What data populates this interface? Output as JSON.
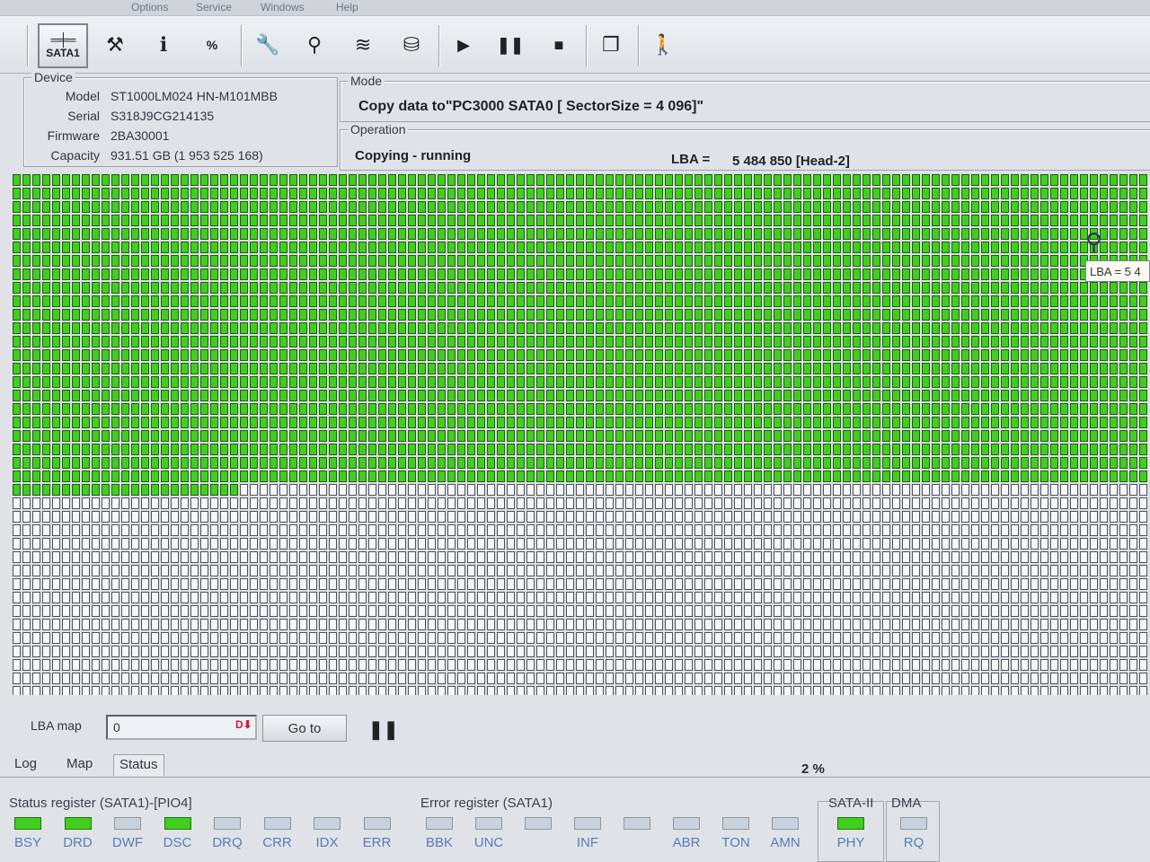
{
  "menubar": [
    "Options",
    "Service",
    "Windows",
    "Help"
  ],
  "toolbar": {
    "sata_label": "SATA1",
    "buttons": [
      "tools-icon",
      "info-icon",
      "percent-icon",
      "key-icon",
      "binoculars-icon",
      "disk-stack-icon",
      "drive-icon",
      "play-icon",
      "pause-icon",
      "stop-icon",
      "windows-icon",
      "exit-icon"
    ]
  },
  "device": {
    "title": "Device",
    "model_label": "Model",
    "model": "ST1000LM024 HN-M101MBB",
    "serial_label": "Serial",
    "serial": "S318J9CG214135",
    "firmware_label": "Firmware",
    "firmware": "2BA30001",
    "capacity_label": "Capacity",
    "capacity": "931.51 GB (1 953 525 168)"
  },
  "mode": {
    "title": "Mode",
    "value": "Copy data to\"PC3000 SATA0 [ SectorSize = 4 096]\""
  },
  "operation": {
    "title": "Operation",
    "value": "Copying - running",
    "lba_label": "LBA =",
    "lba_value": "5 484 850  [Head-2]"
  },
  "map": {
    "done_color": "#3fcf1c",
    "todo_color": "#f6f7f8",
    "tooltip": "LBA = 5 4"
  },
  "lba_map": {
    "label": "LBA map",
    "value": "0",
    "goto": "Go to"
  },
  "tabs": [
    "Log",
    "Map",
    "Status"
  ],
  "progress": "2 %",
  "status_register": {
    "title": "Status register (SATA1)-[PIO4]",
    "bits": [
      {
        "name": "BSY",
        "on": true
      },
      {
        "name": "DRD",
        "on": true
      },
      {
        "name": "DWF",
        "on": false
      },
      {
        "name": "DSC",
        "on": true
      },
      {
        "name": "DRQ",
        "on": false
      },
      {
        "name": "CRR",
        "on": false
      },
      {
        "name": "IDX",
        "on": false
      },
      {
        "name": "ERR",
        "on": false
      }
    ]
  },
  "error_register": {
    "title": "Error register (SATA1)",
    "bits": [
      {
        "name": "BBK",
        "on": false
      },
      {
        "name": "UNC",
        "on": false
      },
      {
        "name": "",
        "on": false
      },
      {
        "name": "INF",
        "on": false
      },
      {
        "name": "",
        "on": false
      },
      {
        "name": "ABR",
        "on": false
      },
      {
        "name": "TON",
        "on": false
      },
      {
        "name": "AMN",
        "on": false
      }
    ]
  },
  "sata2": {
    "title": "SATA-II",
    "bit": "PHY",
    "on": true
  },
  "dma": {
    "title": "DMA",
    "bit": "RQ",
    "on": false
  }
}
